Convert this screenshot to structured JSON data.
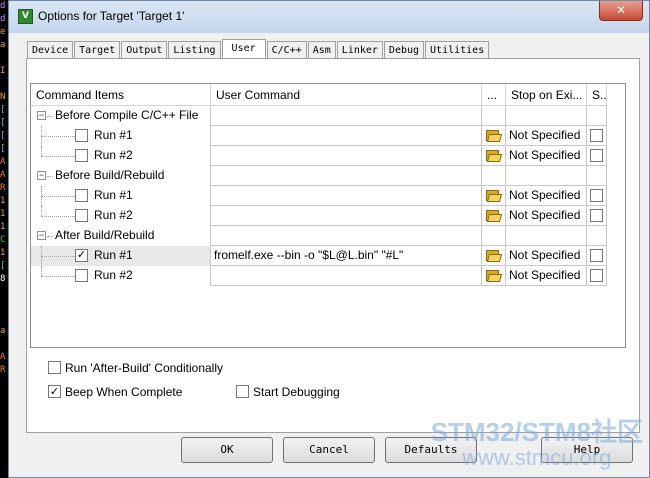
{
  "window": {
    "title": "Options for Target 'Target 1'",
    "close_glyph": "✕",
    "app_icon": "keil-uvision-icon"
  },
  "tabs": [
    "Device",
    "Target",
    "Output",
    "Listing",
    "User",
    "C/C++",
    "Asm",
    "Linker",
    "Debug",
    "Utilities"
  ],
  "active_tab": "User",
  "table": {
    "headers": {
      "command_items": "Command Items",
      "user_command": "User Command",
      "browse": "...",
      "stop_on_exit": "Stop on Exi...",
      "s": "S..."
    },
    "groups": [
      {
        "label": "Before Compile C/C++ File",
        "expander": "−",
        "runs": [
          {
            "label": "Run #1",
            "checked": false,
            "command": "",
            "stop": "Not Specified",
            "s_checked": false
          },
          {
            "label": "Run #2",
            "checked": false,
            "command": "",
            "stop": "Not Specified",
            "s_checked": false
          }
        ]
      },
      {
        "label": "Before Build/Rebuild",
        "expander": "−",
        "runs": [
          {
            "label": "Run #1",
            "checked": false,
            "command": "",
            "stop": "Not Specified",
            "s_checked": false
          },
          {
            "label": "Run #2",
            "checked": false,
            "command": "",
            "stop": "Not Specified",
            "s_checked": false
          }
        ]
      },
      {
        "label": "After Build/Rebuild",
        "expander": "−",
        "runs": [
          {
            "label": "Run #1",
            "checked": true,
            "command": "fromelf.exe --bin -o \"$L@L.bin\" \"#L\"",
            "stop": "Not Specified",
            "s_checked": false
          },
          {
            "label": "Run #2",
            "checked": false,
            "command": "",
            "stop": "Not Specified",
            "s_checked": false
          }
        ]
      }
    ]
  },
  "options": {
    "run_after_build": {
      "label": "Run 'After-Build' Conditionally",
      "checked": false
    },
    "beep": {
      "label": "Beep When Complete",
      "checked": true
    },
    "start_debug": {
      "label": "Start Debugging",
      "checked": false
    }
  },
  "buttons": {
    "ok": "OK",
    "cancel": "Cancel",
    "defaults": "Defaults",
    "help": "Help"
  },
  "watermark": {
    "line1": "STM32/STM8社区",
    "line2": "www.stmcu.org"
  },
  "background_strip": [
    "d",
    "d",
    "e",
    "a",
    "",
    "I",
    "",
    "N",
    "[",
    "[",
    "[",
    "[",
    "A",
    "A",
    "R",
    "1",
    "1",
    "1",
    "C",
    "1",
    "[",
    "8",
    "",
    "",
    "",
    "a",
    "",
    "A",
    "R"
  ],
  "check_glyph": "✓"
}
